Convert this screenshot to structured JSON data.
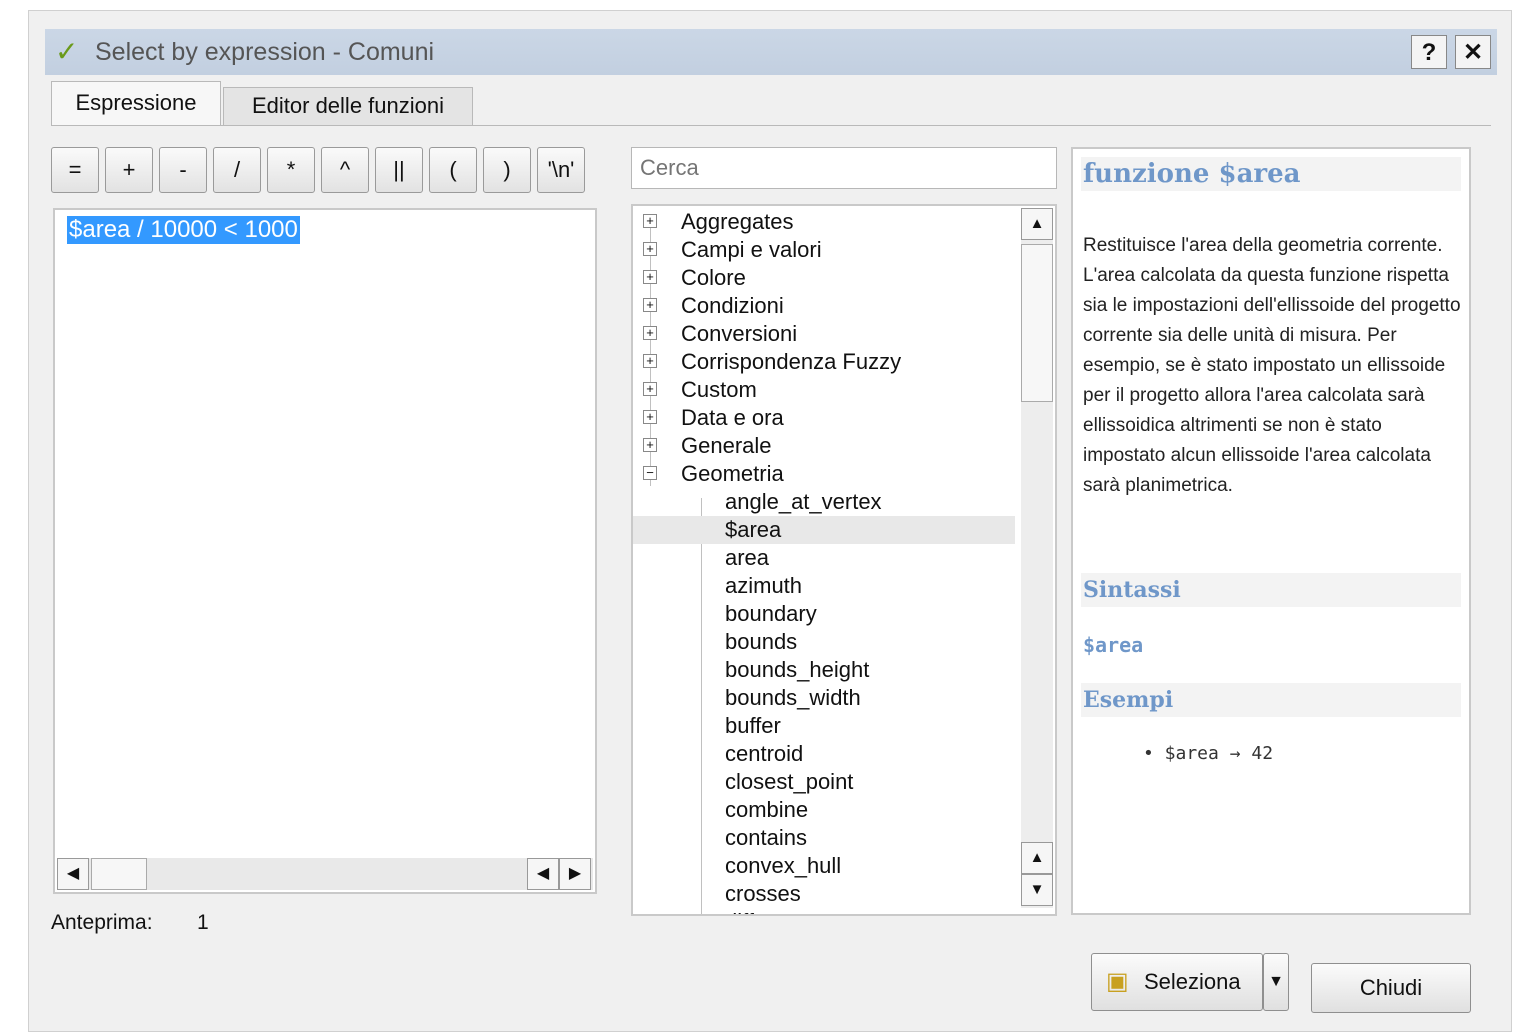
{
  "window": {
    "title": "Select by expression - Comuni",
    "help_label": "?",
    "close_label": "✕"
  },
  "tabs": [
    {
      "label": "Espressione"
    },
    {
      "label": "Editor delle funzioni"
    }
  ],
  "operators": [
    "=",
    "+",
    "-",
    "/",
    "*",
    "^",
    "||",
    "(",
    ")",
    "'\\n'"
  ],
  "editor": {
    "expression": "$area  / 10000 < 1000"
  },
  "preview": {
    "label": "Anteprima:",
    "value": "1"
  },
  "search": {
    "placeholder": "Cerca"
  },
  "tree": {
    "groups": [
      "Aggregates",
      "Campi e valori",
      "Colore",
      "Condizioni",
      "Conversioni",
      "Corrispondenza Fuzzy",
      "Custom",
      "Data e ora",
      "Generale",
      "Geometria"
    ],
    "children": [
      "angle_at_vertex",
      "$area",
      "area",
      "azimuth",
      "boundary",
      "bounds",
      "bounds_height",
      "bounds_width",
      "buffer",
      "centroid",
      "closest_point",
      "combine",
      "contains",
      "convex_hull",
      "crosses",
      "difference"
    ],
    "selected": "$area"
  },
  "help": {
    "title": "funzione $area",
    "description": "Restituisce l'area della geometria corrente. L'area calcolata da questa funzione rispetta sia le impostazioni dell'ellissoide del progetto corrente sia delle unità di misura. Per esempio, se è stato impostato un ellissoide per il progetto allora l'area calcolata sarà ellissoidica altrimenti se non è stato impostato alcun ellissoide l'area calcolata sarà planimetrica.",
    "syntax_heading": "Sintassi",
    "syntax": "$area",
    "examples_heading": "Esempi",
    "example": "• $area → 42"
  },
  "buttons": {
    "select": "Seleziona",
    "close": "Chiudi"
  }
}
